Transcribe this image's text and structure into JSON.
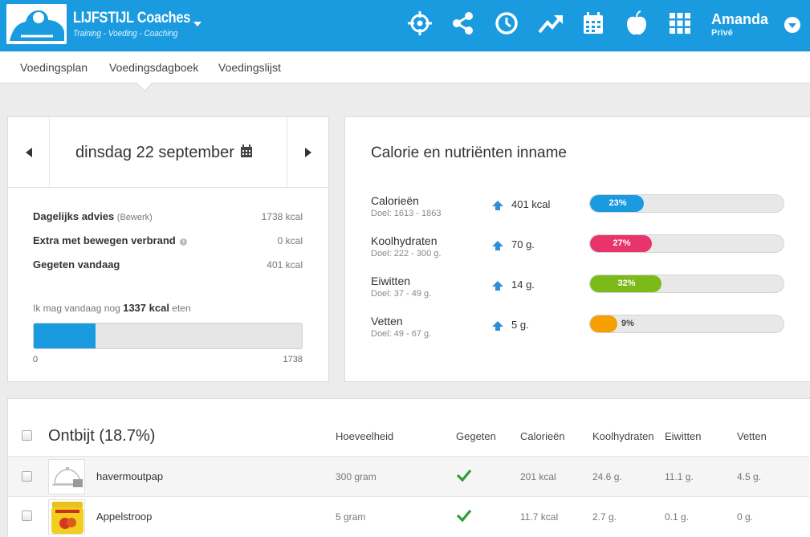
{
  "header": {
    "logo_title": "LIJFSTIJL Coaches",
    "logo_subtitle": "Training - Voeding - Coaching",
    "nav_icons": [
      "target-icon",
      "share-icon",
      "clock-icon",
      "trending-icon",
      "calendar-icon",
      "apple-icon",
      "grid-icon"
    ],
    "user_name": "Amanda",
    "user_sub": "Privé",
    "brand_color": "#1a9be0"
  },
  "subnav": {
    "items": [
      "Voedingsplan",
      "Voedingsdagboek",
      "Voedingslijst"
    ],
    "active": "Voedingsdagboek"
  },
  "day": {
    "date": "dinsdag 22 september",
    "advice_label": "Dagelijks advies",
    "advice_edit": "(Bewerk)",
    "advice_value": "1738 kcal",
    "extra_label": "Extra met bewegen verbrand",
    "extra_value": "0 kcal",
    "eaten_label": "Gegeten vandaag",
    "eaten_value": "401 kcal",
    "remain_prefix": "Ik mag vandaag nog",
    "remain_value": "1337 kcal",
    "remain_suffix": "eten",
    "bar_fraction": 0.23,
    "bar_min": "0",
    "bar_max": "1738"
  },
  "nutrients": {
    "title": "Calorie en nutriënten inname",
    "rows": [
      {
        "name": "Calorieën",
        "goal": "Doel: 1613 - 1863",
        "value": "401 kcal",
        "percent": "23%",
        "fraction": 0.23,
        "color": "#1a9be0"
      },
      {
        "name": "Koolhydraten",
        "goal": "Doel: 222 - 300 g.",
        "value": "70 g.",
        "percent": "27%",
        "fraction": 0.27,
        "color": "#e8336b"
      },
      {
        "name": "Eiwitten",
        "goal": "Doel: 37 - 49 g.",
        "value": "14 g.",
        "percent": "32%",
        "fraction": 0.32,
        "color": "#7cba19"
      },
      {
        "name": "Vetten",
        "goal": "Doel: 49 - 67 g.",
        "value": "5 g.",
        "percent": "9%",
        "fraction": 0.09,
        "color": "#f5a000"
      }
    ]
  },
  "meal": {
    "title": "Ontbijt (18.7%)",
    "columns": {
      "amount": "Hoeveelheid",
      "eaten": "Gegeten",
      "calories": "Calorieën",
      "carbs": "Koolhydraten",
      "protein": "Eiwitten",
      "fat": "Vetten"
    },
    "rows": [
      {
        "name": "havermoutpap",
        "amount": "300 gram",
        "calories": "201 kcal",
        "carbs": "24.6 g.",
        "protein": "11.1 g.",
        "fat": "4.5 g."
      },
      {
        "name": "Appelstroop",
        "amount": "5 gram",
        "calories": "11.7 kcal",
        "carbs": "2.7 g.",
        "protein": "0.1 g.",
        "fat": "0 g."
      }
    ]
  }
}
